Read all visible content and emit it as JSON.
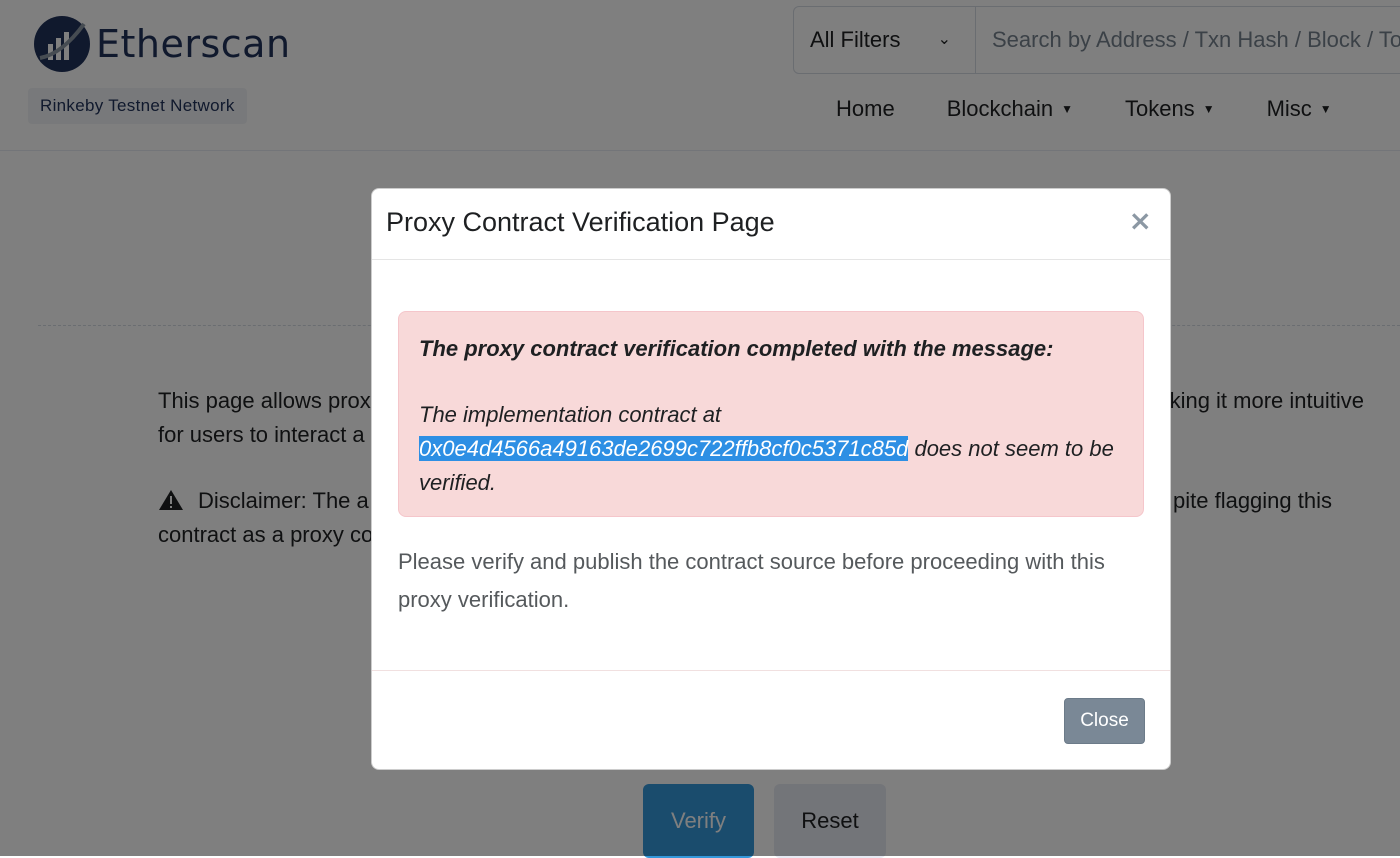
{
  "header": {
    "logo_text": "Etherscan",
    "network_badge": "Rinkeby Testnet Network",
    "filter_label": "All Filters",
    "search_placeholder": "Search by Address / Txn Hash / Block / Token / Ens",
    "nav": [
      {
        "label": "Home"
      },
      {
        "label": "Blockchain"
      },
      {
        "label": "Tokens"
      },
      {
        "label": "Misc"
      }
    ]
  },
  "page": {
    "intro_left": "This page allows prox",
    "intro_right": "king it more intuitive",
    "intro_line2": "for users to interact a",
    "disclaimer_left": "Disclaimer: The a",
    "disclaimer_right": "pite flagging this",
    "disclaimer_line2": "contract as a proxy co",
    "verify_label": "Verify",
    "reset_label": "Reset"
  },
  "modal": {
    "title": "Proxy Contract Verification Page",
    "close_x": "×",
    "alert_title": "The proxy contract verification completed with the message:",
    "alert_prefix": "The implementation contract at",
    "alert_address": "0x0e4d4566a49163de2699c722ffb8cf0c5371c85d",
    "alert_suffix": " does not seem to be verified.",
    "body_text": "Please verify and publish the contract source before proceeding with this proxy verification.",
    "close_label": "Close"
  },
  "colors": {
    "brand": "#21325b",
    "alert_bg": "#f8d9d9",
    "selection": "#2d8fe4",
    "verify_button": "#3498db",
    "close_button": "#7a8896"
  }
}
